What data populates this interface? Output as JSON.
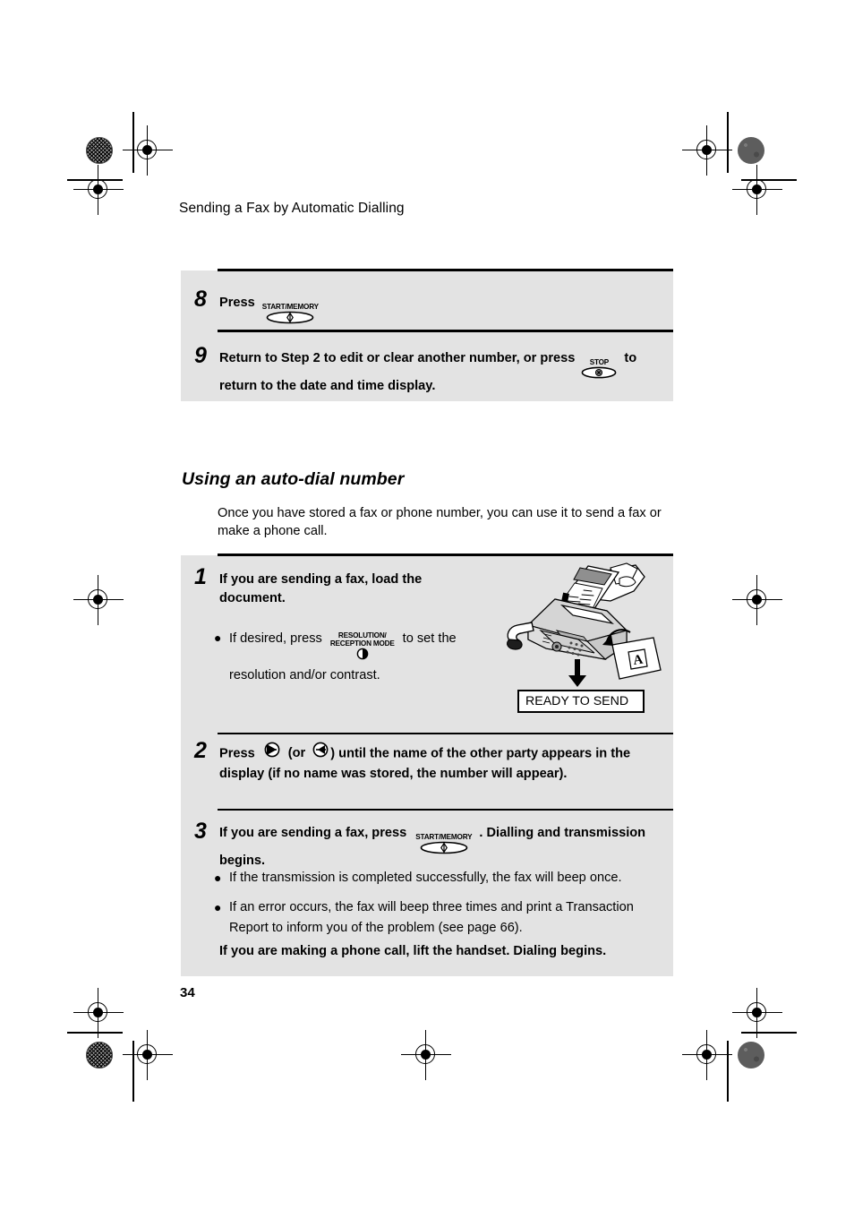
{
  "page": {
    "running_head": "Sending a Fax by Automatic Dialling",
    "folio": "34",
    "box_fill": "#e3e3e3",
    "rule_color": "#000000"
  },
  "first_group": {
    "steps": [
      {
        "number": "8",
        "text_before": "Press",
        "key": {
          "label": "START/MEMORY",
          "icon": "start-memory-key-icon"
        },
        "text_after": ""
      },
      {
        "number": "9",
        "text_before": "Return to Step 2 to edit or clear another number, or press",
        "key": {
          "label": "STOP",
          "icon": "stop-key-icon"
        },
        "text_after": "to",
        "text_line2": "return to the date and time display."
      }
    ]
  },
  "section": {
    "title": "Using an auto-dial number",
    "intro": "Once you have stored a fax or phone number, you can use it to send a fax or make a phone call."
  },
  "procedure": {
    "steps": [
      {
        "number": "1",
        "heading_line1": "If you are sending a fax, load the",
        "heading_line2": "document.",
        "bullet_part1": "If desired, press",
        "key": {
          "label_line1": "RESOLUTION/",
          "label_line2": "RECEPTION MODE",
          "icon": "resolution-reception-mode-key-icon"
        },
        "bullet_part2": "to set the",
        "bullet_line2": "resolution and/or contrast.",
        "illustration": {
          "name": "fax-machine-load-document-illustration",
          "arrow": "down-arrow-icon",
          "display_readout": "READY TO SEND"
        }
      },
      {
        "number": "2",
        "text_part1": "Press",
        "key_right": {
          "icon": "right-arrow-key-icon"
        },
        "text_part2": "(or",
        "key_left": {
          "icon": "left-arrow-key-icon"
        },
        "text_part3": ") until the name of the other party appears in the",
        "text_line2": "display (if no name was stored, the number will appear)."
      },
      {
        "number": "3",
        "text_part1": "If you are sending a fax, press",
        "key": {
          "label": "START/MEMORY",
          "icon": "start-memory-key-icon"
        },
        "text_part2": ". Dialling and transmission",
        "text_line2": "begins.",
        "bullets": [
          "If the transmission is completed successfully, the fax will beep once.",
          "If an error occurs, the fax will beep three times and print a Transaction Report to inform you of the problem (see page 66)."
        ],
        "closing": "If you are making a phone call, lift the handset. Dialing begins."
      }
    ]
  }
}
